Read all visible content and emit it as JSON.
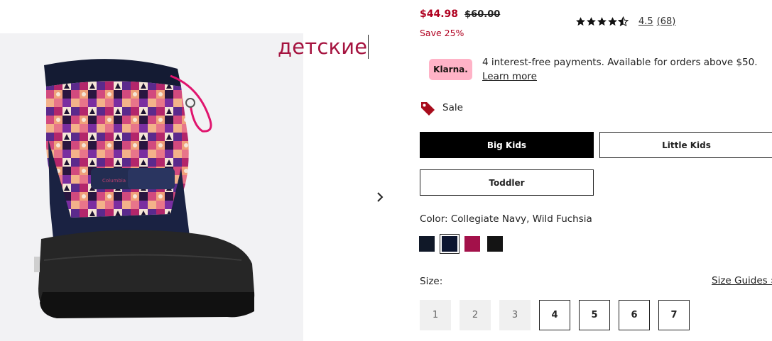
{
  "overlay": {
    "text": "детские"
  },
  "price": {
    "sale": "$44.98",
    "original": "$60.00",
    "save": "Save 25%"
  },
  "rating": {
    "value": "4.5",
    "count": "(68)",
    "stars": 4.5
  },
  "klarna": {
    "badge": "Klarna.",
    "text": "4 interest-free payments. Available for orders above $50.",
    "link": "Learn more"
  },
  "sale_tag": {
    "label": "Sale"
  },
  "age_options": [
    {
      "label": "Big Kids",
      "selected": true
    },
    {
      "label": "Little Kids",
      "selected": false
    },
    {
      "label": "Toddler",
      "selected": false
    }
  ],
  "color": {
    "label": "Color: Collegiate Navy, Wild Fuchsia",
    "swatches": [
      "#101828",
      "#0c1530",
      "#a3114a",
      "#141414"
    ],
    "selected_index": 1
  },
  "size": {
    "label": "Size:",
    "guides": "Size Guides ›",
    "options": [
      {
        "label": "1",
        "available": false
      },
      {
        "label": "2",
        "available": false
      },
      {
        "label": "3",
        "available": false
      },
      {
        "label": "4",
        "available": true
      },
      {
        "label": "5",
        "available": true
      },
      {
        "label": "6",
        "available": true
      },
      {
        "label": "7",
        "available": true
      }
    ]
  },
  "colors": {
    "sale_red": "#b00020",
    "klarna_pink": "#ffb3c7",
    "overlay_text": "#a5133f"
  }
}
